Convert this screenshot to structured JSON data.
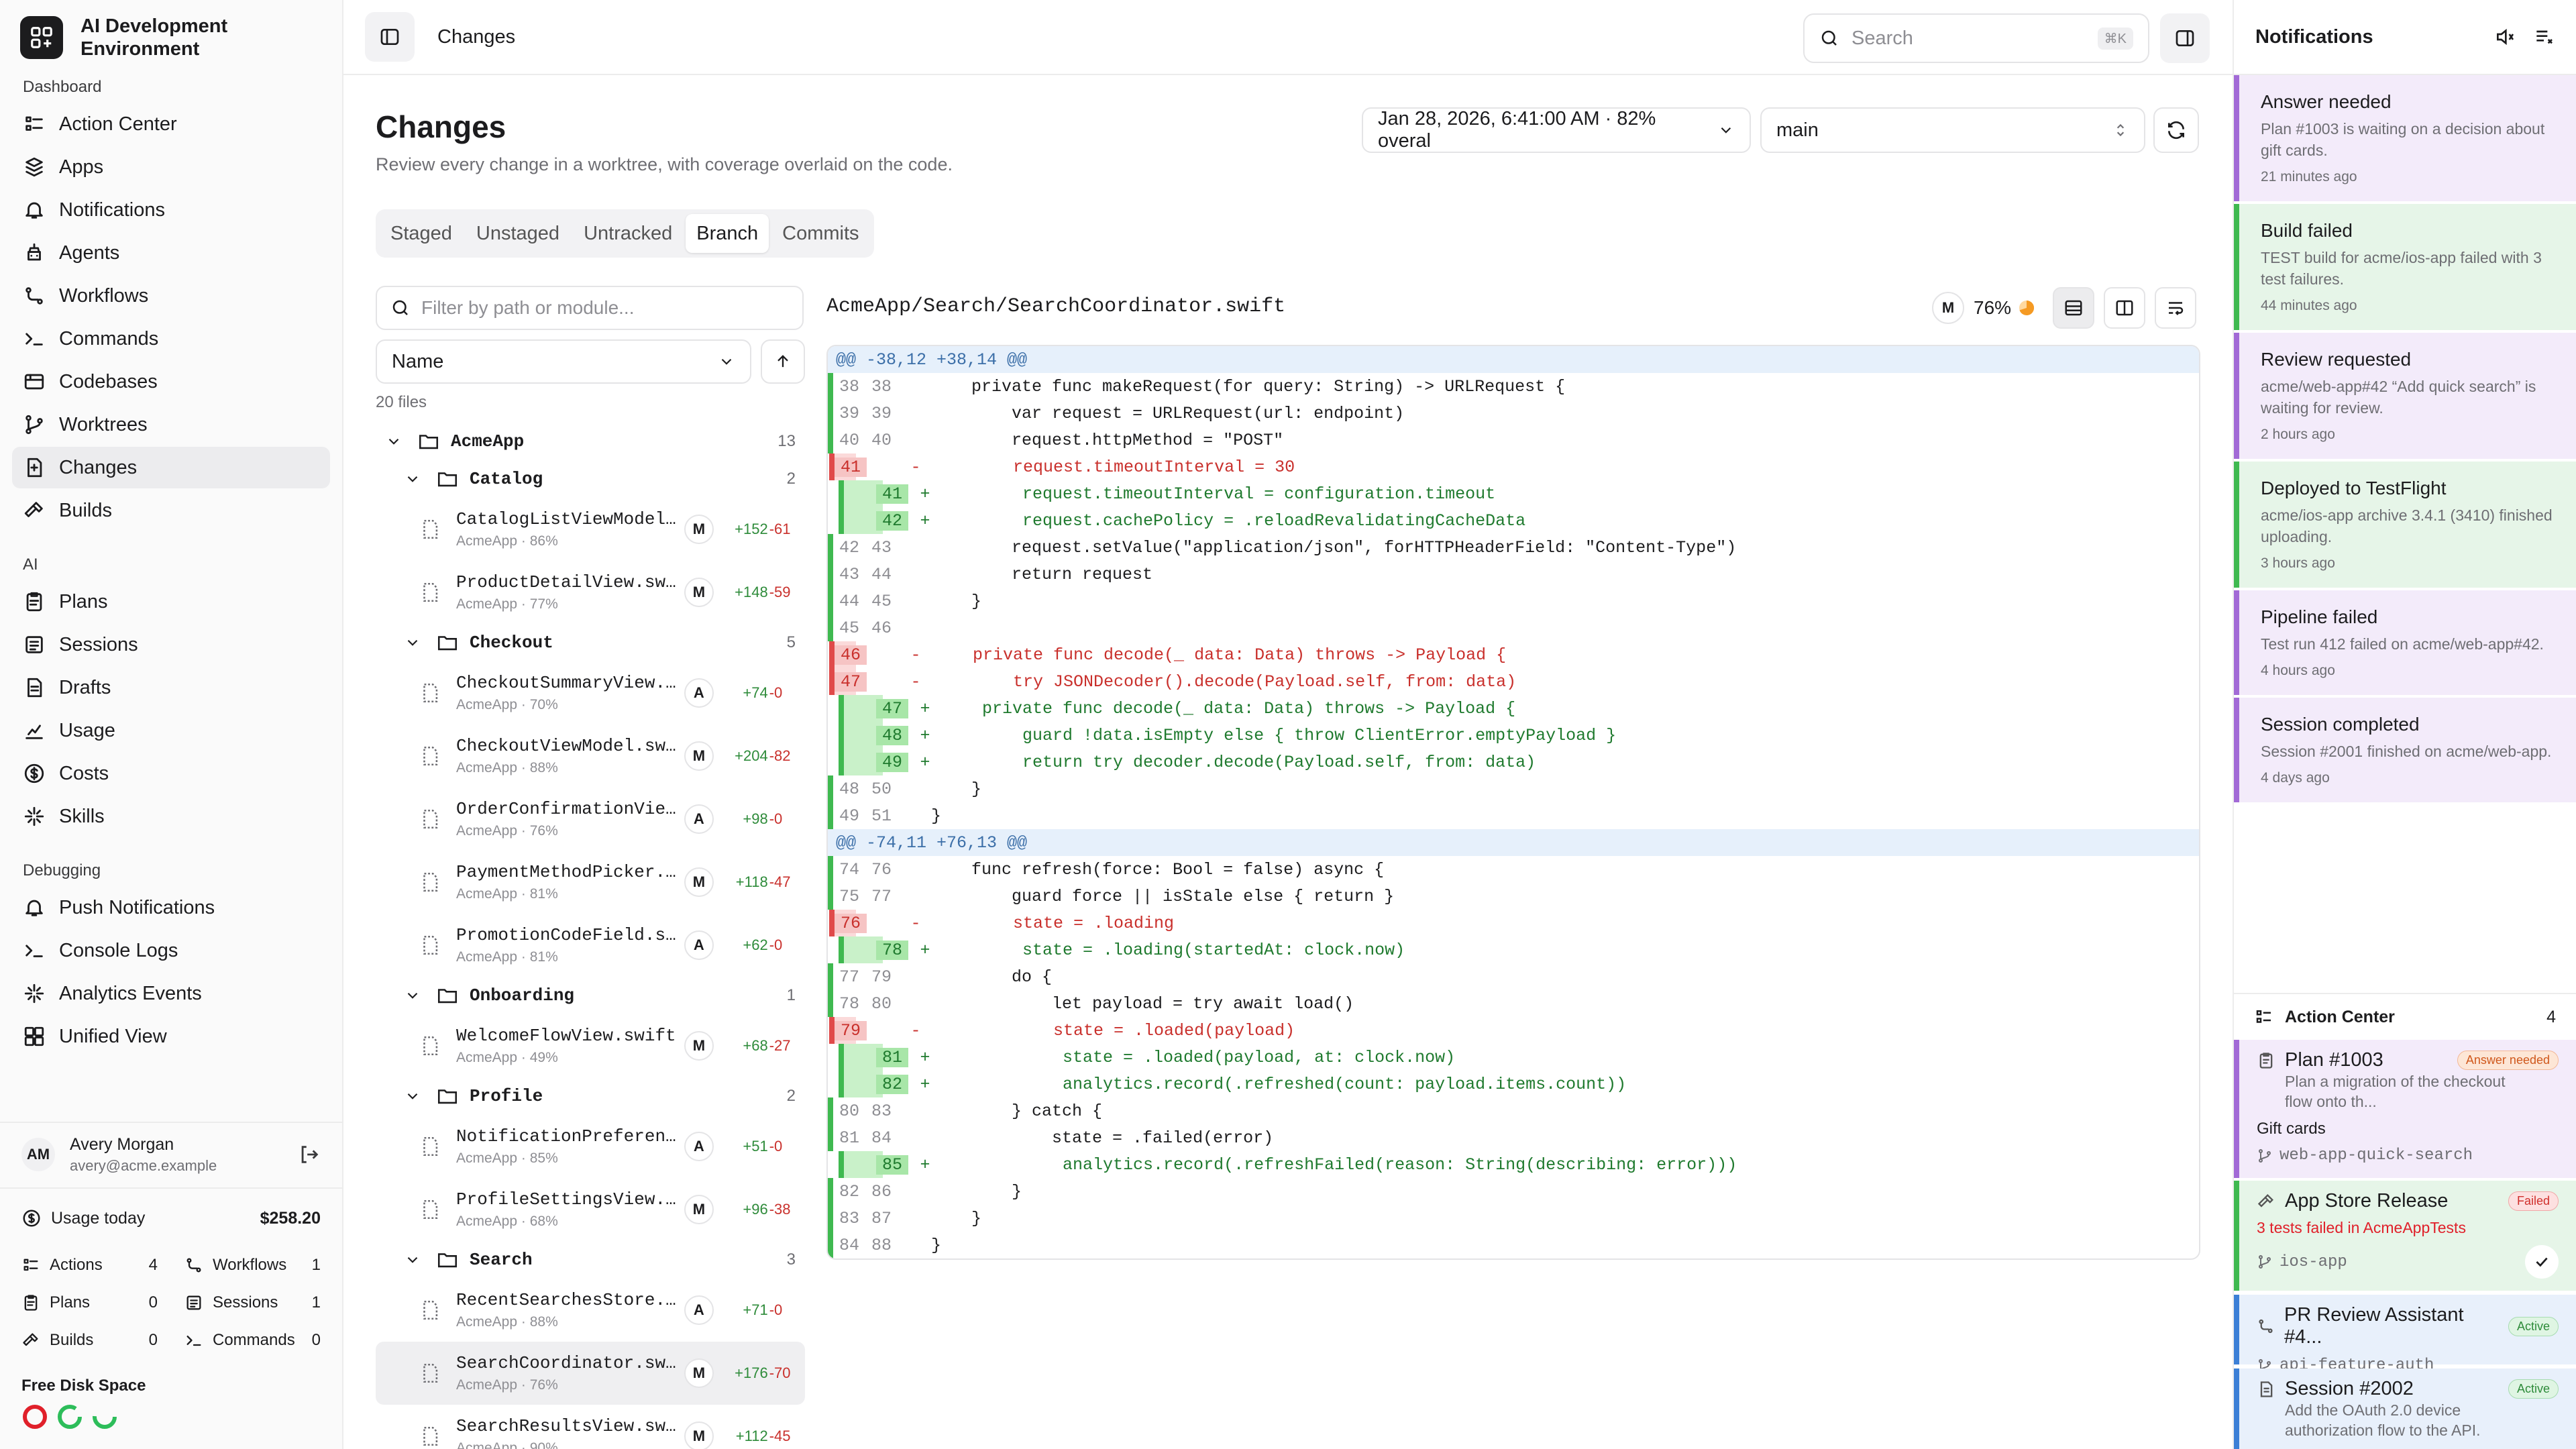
{
  "app": {
    "title": "AI Development Environment"
  },
  "sidebar": {
    "sections": [
      {
        "label": "Dashboard",
        "items": [
          {
            "label": "Action Center",
            "icon": "action-center-icon"
          },
          {
            "label": "Apps",
            "icon": "apps-icon"
          },
          {
            "label": "Notifications",
            "icon": "bell-icon"
          },
          {
            "label": "Agents",
            "icon": "agents-icon"
          },
          {
            "label": "Workflows",
            "icon": "workflows-icon"
          },
          {
            "label": "Commands",
            "icon": "terminal-icon"
          },
          {
            "label": "Codebases",
            "icon": "codebases-icon"
          },
          {
            "label": "Worktrees",
            "icon": "branch-icon"
          },
          {
            "label": "Changes",
            "icon": "changes-icon",
            "active": true
          },
          {
            "label": "Builds",
            "icon": "hammer-icon"
          }
        ]
      },
      {
        "label": "AI",
        "items": [
          {
            "label": "Plans",
            "icon": "plans-icon"
          },
          {
            "label": "Sessions",
            "icon": "sessions-icon"
          },
          {
            "label": "Drafts",
            "icon": "drafts-icon"
          },
          {
            "label": "Usage",
            "icon": "chart-icon"
          },
          {
            "label": "Costs",
            "icon": "dollar-icon"
          },
          {
            "label": "Skills",
            "icon": "sparkle-icon"
          }
        ]
      },
      {
        "label": "Debugging",
        "items": [
          {
            "label": "Push Notifications",
            "icon": "bell-icon"
          },
          {
            "label": "Console Logs",
            "icon": "terminal-icon"
          },
          {
            "label": "Analytics Events",
            "icon": "sparkle-icon"
          },
          {
            "label": "Unified View",
            "icon": "unified-icon"
          }
        ]
      }
    ],
    "user": {
      "initials": "AM",
      "name": "Avery Morgan",
      "email": "avery@acme.example"
    },
    "usage": {
      "today_label": "Usage today",
      "today_value": "$258.20",
      "stats": [
        {
          "label": "Actions",
          "value": "4"
        },
        {
          "label": "Workflows",
          "value": "1"
        },
        {
          "label": "Plans",
          "value": "0"
        },
        {
          "label": "Sessions",
          "value": "1"
        },
        {
          "label": "Builds",
          "value": "0"
        },
        {
          "label": "Commands",
          "value": "0"
        }
      ],
      "disk_label": "Free Disk Space"
    }
  },
  "topbar": {
    "title": "Changes",
    "search_placeholder": "Search",
    "search_shortcut": "⌘K"
  },
  "main": {
    "title": "Changes",
    "subtitle": "Review every change in a worktree, with coverage overlaid on the code.",
    "snapshot": "Jan 28, 2026, 6:41:00 AM · 82% overal",
    "branch": "main",
    "tabs": [
      "Staged",
      "Unstaged",
      "Untracked",
      "Branch",
      "Commits"
    ],
    "active_tab": "Branch",
    "filter_placeholder": "Filter by path or module...",
    "sort_label": "Name",
    "file_count": "20 files"
  },
  "tree": {
    "root": {
      "name": "AcmeApp",
      "count": "13"
    },
    "groups": [
      {
        "name": "Catalog",
        "count": "2",
        "files": [
          {
            "name": "CatalogListViewModel.swift",
            "meta": "AcmeApp · 86%",
            "status": "M",
            "add": "+152",
            "del": "-61"
          },
          {
            "name": "ProductDetailView.swift",
            "meta": "AcmeApp · 77%",
            "status": "M",
            "add": "+148",
            "del": "-59"
          }
        ]
      },
      {
        "name": "Checkout",
        "count": "5",
        "files": [
          {
            "name": "CheckoutSummaryView.swift",
            "meta": "AcmeApp · 70%",
            "status": "A",
            "add": "+74",
            "del": "-0"
          },
          {
            "name": "CheckoutViewModel.swift",
            "meta": "AcmeApp · 88%",
            "status": "M",
            "add": "+204",
            "del": "-82"
          },
          {
            "name": "OrderConfirmationView.swift",
            "meta": "AcmeApp · 76%",
            "status": "A",
            "add": "+98",
            "del": "-0"
          },
          {
            "name": "PaymentMethodPicker.swift",
            "meta": "AcmeApp · 81%",
            "status": "M",
            "add": "+118",
            "del": "-47"
          },
          {
            "name": "PromotionCodeField.swift",
            "meta": "AcmeApp · 81%",
            "status": "A",
            "add": "+62",
            "del": "-0"
          }
        ]
      },
      {
        "name": "Onboarding",
        "count": "1",
        "files": [
          {
            "name": "WelcomeFlowView.swift",
            "meta": "AcmeApp · 49%",
            "status": "M",
            "add": "+68",
            "del": "-27"
          }
        ]
      },
      {
        "name": "Profile",
        "count": "2",
        "files": [
          {
            "name": "NotificationPreferencesView.swift",
            "meta": "AcmeApp · 85%",
            "status": "A",
            "add": "+51",
            "del": "-0"
          },
          {
            "name": "ProfileSettingsView.swift",
            "meta": "AcmeApp · 68%",
            "status": "M",
            "add": "+96",
            "del": "-38"
          }
        ]
      },
      {
        "name": "Search",
        "count": "3",
        "files": [
          {
            "name": "RecentSearchesStore.swift",
            "meta": "AcmeApp · 88%",
            "status": "A",
            "add": "+71",
            "del": "-0"
          },
          {
            "name": "SearchCoordinator.swift",
            "meta": "AcmeApp · 76%",
            "status": "M",
            "add": "+176",
            "del": "-70",
            "active": true
          },
          {
            "name": "SearchResultsView.swift",
            "meta": "AcmeApp · 90%",
            "status": "M",
            "add": "+112",
            "del": "-45"
          }
        ]
      }
    ]
  },
  "diff": {
    "path": "AcmeApp/Search/SearchCoordinator.swift",
    "status": "M",
    "coverage": "76%",
    "lines": [
      {
        "t": "hunk",
        "code": "@@ -38,12 +38,14 @@"
      },
      {
        "t": "ctx",
        "o": "38",
        "n": "38",
        "code": "    private func makeRequest(for query: String) -> URLRequest {"
      },
      {
        "t": "ctx",
        "o": "39",
        "n": "39",
        "code": "        var request = URLRequest(url: endpoint)"
      },
      {
        "t": "ctx",
        "o": "40",
        "n": "40",
        "code": "        request.httpMethod = \"POST\""
      },
      {
        "t": "del",
        "o": "41",
        "n": "",
        "code": "        request.timeoutInterval = 30"
      },
      {
        "t": "add",
        "o": "",
        "n": "41",
        "code": "        request.timeoutInterval = configuration.timeout"
      },
      {
        "t": "add",
        "o": "",
        "n": "42",
        "code": "        request.cachePolicy = .reloadRevalidatingCacheData"
      },
      {
        "t": "ctx",
        "o": "42",
        "n": "43",
        "code": "        request.setValue(\"application/json\", forHTTPHeaderField: \"Content-Type\")"
      },
      {
        "t": "ctx",
        "o": "43",
        "n": "44",
        "code": "        return request"
      },
      {
        "t": "ctx",
        "o": "44",
        "n": "45",
        "code": "    }"
      },
      {
        "t": "ctx",
        "o": "45",
        "n": "46",
        "code": ""
      },
      {
        "t": "del",
        "o": "46",
        "n": "",
        "code": "    private func decode(_ data: Data) throws -> Payload {"
      },
      {
        "t": "del",
        "o": "47",
        "n": "",
        "code": "        try JSONDecoder().decode(Payload.self, from: data)"
      },
      {
        "t": "add",
        "o": "",
        "n": "47",
        "code": "    private func decode(_ data: Data) throws -> Payload {"
      },
      {
        "t": "add",
        "o": "",
        "n": "48",
        "code": "        guard !data.isEmpty else { throw ClientError.emptyPayload }"
      },
      {
        "t": "add",
        "o": "",
        "n": "49",
        "code": "        return try decoder.decode(Payload.self, from: data)"
      },
      {
        "t": "ctx",
        "o": "48",
        "n": "50",
        "code": "    }"
      },
      {
        "t": "ctx",
        "o": "49",
        "n": "51",
        "code": "}"
      },
      {
        "t": "hunk",
        "code": "@@ -74,11 +76,13 @@"
      },
      {
        "t": "ctx",
        "o": "74",
        "n": "76",
        "code": "    func refresh(force: Bool = false) async {"
      },
      {
        "t": "ctx",
        "o": "75",
        "n": "77",
        "code": "        guard force || isStale else { return }"
      },
      {
        "t": "del",
        "o": "76",
        "n": "",
        "code": "        state = .loading"
      },
      {
        "t": "add",
        "o": "",
        "n": "78",
        "code": "        state = .loading(startedAt: clock.now)"
      },
      {
        "t": "ctx",
        "o": "77",
        "n": "79",
        "code": "        do {"
      },
      {
        "t": "ctx",
        "o": "78",
        "n": "80",
        "code": "            let payload = try await load()"
      },
      {
        "t": "del",
        "o": "79",
        "n": "",
        "code": "            state = .loaded(payload)"
      },
      {
        "t": "add",
        "o": "",
        "n": "81",
        "code": "            state = .loaded(payload, at: clock.now)"
      },
      {
        "t": "add",
        "o": "",
        "n": "82",
        "code": "            analytics.record(.refreshed(count: payload.items.count))"
      },
      {
        "t": "ctx",
        "o": "80",
        "n": "83",
        "code": "        } catch {"
      },
      {
        "t": "ctx",
        "o": "81",
        "n": "84",
        "code": "            state = .failed(error)"
      },
      {
        "t": "add",
        "o": "",
        "n": "85",
        "code": "            analytics.record(.refreshFailed(reason: String(describing: error)))"
      },
      {
        "t": "ctx",
        "o": "82",
        "n": "86",
        "code": "        }"
      },
      {
        "t": "ctx",
        "o": "83",
        "n": "87",
        "code": "    }"
      },
      {
        "t": "ctx",
        "o": "84",
        "n": "88",
        "code": "}"
      }
    ]
  },
  "notifications": {
    "title": "Notifications",
    "items": [
      {
        "title": "Answer needed",
        "body": "Plan #1003 is waiting on a decision about gift cards.",
        "time": "21 minutes ago",
        "tone": "purple"
      },
      {
        "title": "Build failed",
        "body": "TEST build for acme/ios-app failed with 3 test failures.",
        "time": "44 minutes ago",
        "tone": "green"
      },
      {
        "title": "Review requested",
        "body": "acme/web-app#42 “Add quick search” is waiting for review.",
        "time": "2 hours ago",
        "tone": "purple"
      },
      {
        "title": "Deployed to TestFlight",
        "body": "acme/ios-app archive 3.4.1 (3410) finished uploading.",
        "time": "3 hours ago",
        "tone": "green"
      },
      {
        "title": "Pipeline failed",
        "body": "Test run 412 failed on acme/web-app#42.",
        "time": "4 hours ago",
        "tone": "purple"
      },
      {
        "title": "Session completed",
        "body": "Session #2001 finished on acme/web-app.",
        "time": "4 days ago",
        "tone": "purple"
      }
    ],
    "action_center": {
      "label": "Action Center",
      "count": "4",
      "cards": [
        {
          "title": "Plan #1003",
          "pill": "Answer needed",
          "sub": "Plan a migration of the checkout flow onto th...",
          "extra": "Gift cards",
          "branch": "web-app-quick-search"
        },
        {
          "title": "App Store Release",
          "pill": "Failed",
          "sub": "3 tests failed in AcmeAppTests",
          "branch": "ios-app"
        },
        {
          "title": "PR Review Assistant #4...",
          "pill": "Active",
          "branch": "api-feature-auth"
        },
        {
          "title": "Session #2002",
          "pill": "Active",
          "sub": "Add the OAuth 2.0 device authorization flow to the API."
        }
      ]
    }
  },
  "colors": {
    "accent_purple": "#a26ad6",
    "accent_green": "#3fb950",
    "add_text": "#1f7a2e",
    "del_text": "#c9302c",
    "hunk_bg": "#e6f0fb"
  }
}
